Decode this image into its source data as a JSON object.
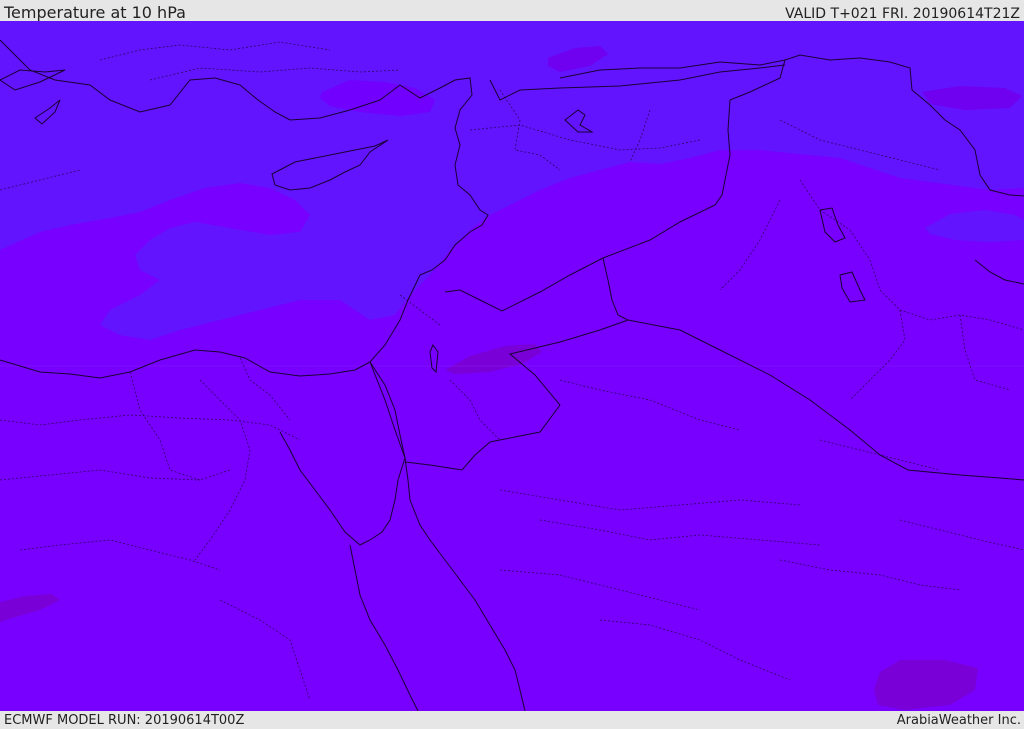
{
  "header": {
    "title": "Temperature at 10 hPa",
    "valid": "VALID T+021 FRI. 20190614T21Z"
  },
  "footer": {
    "model_run": "ECMWF MODEL RUN: 20190614T00Z",
    "credit": "ArabiaWeather Inc."
  },
  "map": {
    "colors": {
      "warm_fill": "#7800ff",
      "cool_fill": "#6214ff",
      "warmer_patch": "#7c00e8",
      "border_line": "#1a0033"
    }
  }
}
